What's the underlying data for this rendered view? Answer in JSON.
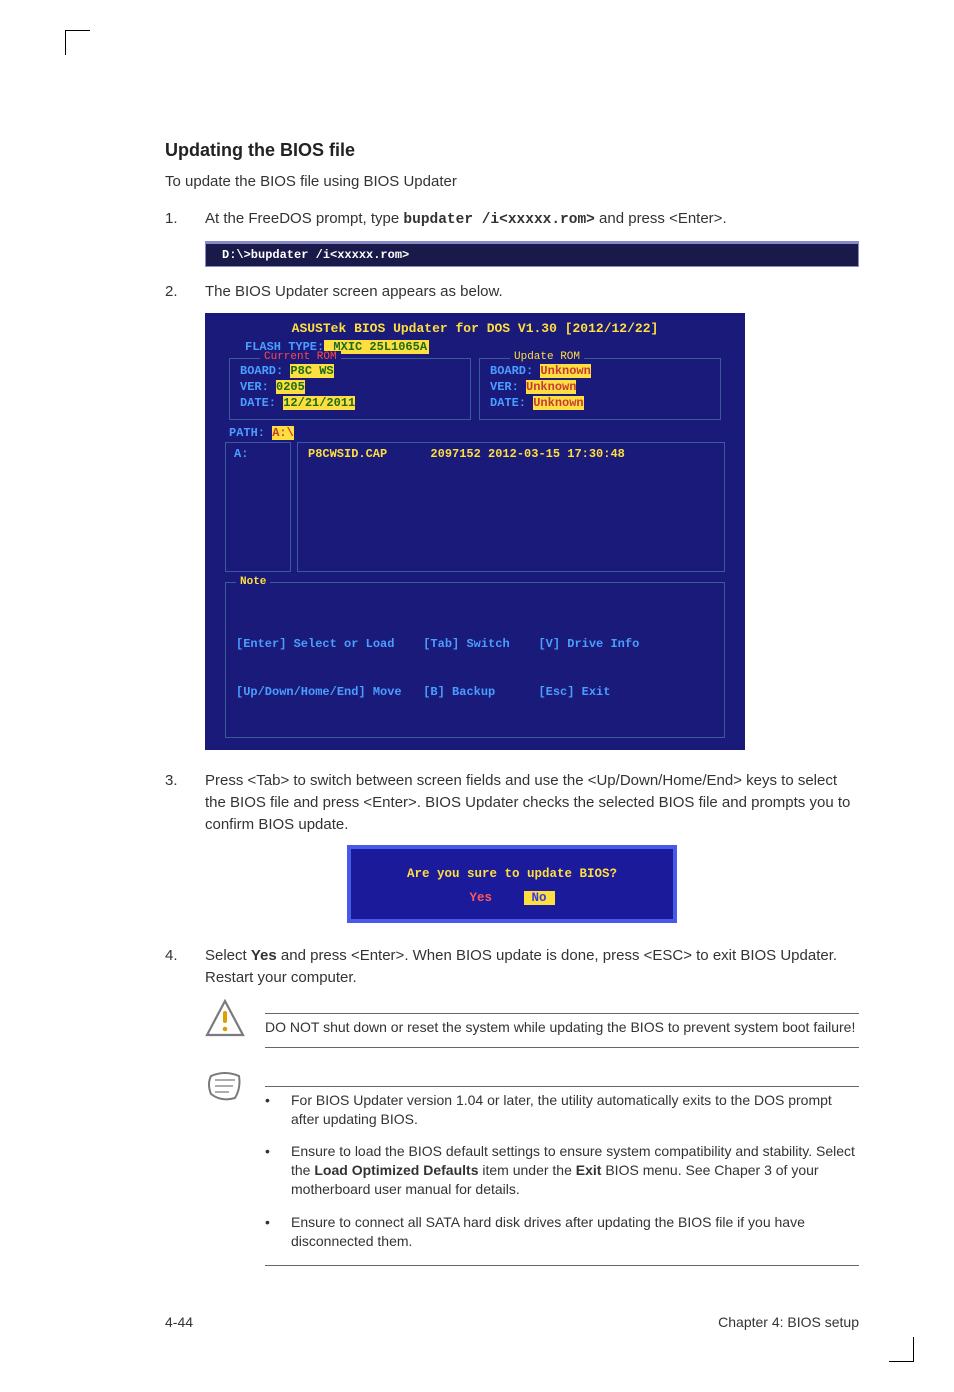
{
  "heading": "Updating the BIOS file",
  "intro": "To update the BIOS file using BIOS Updater",
  "steps": {
    "s1": {
      "num": "1.",
      "pre": "At the FreeDOS prompt, type ",
      "cmd": "bupdater /i<xxxxx.rom>",
      "post": " and press <Enter>."
    },
    "s2": {
      "num": "2.",
      "text": "The BIOS Updater screen appears as below."
    },
    "s3": {
      "num": "3.",
      "text": "Press <Tab> to switch between screen fields and use the <Up/Down/Home/End> keys to select the BIOS file and press <Enter>. BIOS Updater checks the selected BIOS file and prompts you to confirm BIOS update."
    },
    "s4": {
      "num": "4.",
      "pre": "Select ",
      "bold": "Yes",
      "post": " and press <Enter>. When BIOS update is done, press <ESC> to exit BIOS Updater. Restart your computer."
    }
  },
  "cmd_bar": "D:\\>bupdater /i<xxxxx.rom>",
  "bios": {
    "title": "ASUSTek BIOS Updater for DOS V1.30 [2012/12/22]",
    "flash_label": "FLASH TYPE:",
    "flash_val": " MXIC 25L1065A",
    "cur": {
      "legend": "Current ROM",
      "board_l": "BOARD: ",
      "board_v": "P8C WS",
      "ver_l": "VER: ",
      "ver_v": "0205",
      "date_l": "DATE: ",
      "date_v": "12/21/2011"
    },
    "upd": {
      "legend": "Update ROM",
      "board_l": "BOARD: ",
      "board_v": "Unknown",
      "ver_l": "VER: ",
      "ver_v": "Unknown",
      "date_l": "DATE: ",
      "date_v": "Unknown"
    },
    "path_l": "PATH: ",
    "path_v": "A:\\",
    "drive": "A:",
    "file_line": "P8CWSID.CAP      2097152 2012-03-15 17:30:48",
    "note_legend": "Note",
    "note_l1": "[Enter] Select or Load    [Tab] Switch    [V] Drive Info",
    "note_l2": "[Up/Down/Home/End] Move   [B] Backup      [Esc] Exit"
  },
  "dialog": {
    "q": "Are you sure to update BIOS?",
    "yes": "Yes",
    "no": " No "
  },
  "warn": "DO NOT shut down or reset the system while updating the BIOS to prevent system boot failure!",
  "tips": {
    "t1": "For BIOS Updater version 1.04 or later, the utility automatically exits to the DOS prompt after updating BIOS.",
    "t2a": "Ensure to load the BIOS default settings to ensure system compatibility and stability. Select the ",
    "t2b": "Load Optimized Defaults",
    "t2c": " item under the ",
    "t2d": "Exit",
    "t2e": " BIOS menu. See Chaper 3 of your motherboard user manual for details.",
    "t3": "Ensure to connect all SATA hard disk drives after updating the BIOS file if you have disconnected them."
  },
  "footer": {
    "left": "4-44",
    "right": "Chapter 4: BIOS setup"
  },
  "bullet": "•"
}
